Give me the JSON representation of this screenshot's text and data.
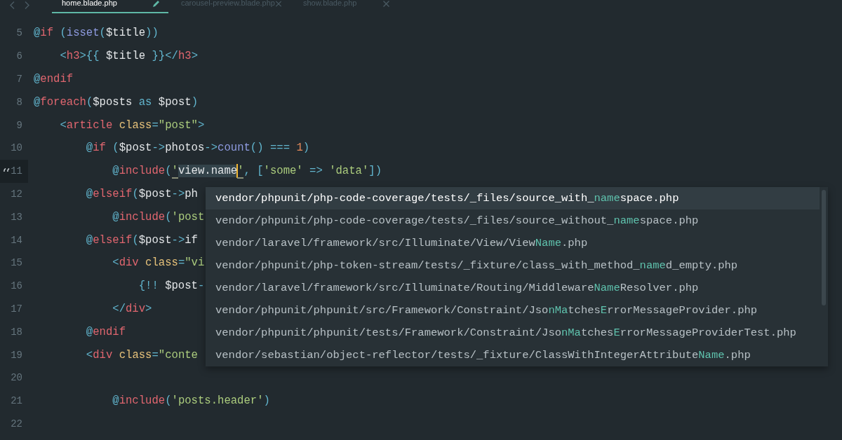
{
  "tabs": [
    {
      "label": "home.blade.php",
      "selected": true,
      "modified": true
    },
    {
      "label": "carousel-preview.blade.php",
      "selected": false,
      "modified": false
    },
    {
      "label": "show.blade.php",
      "selected": false,
      "modified": false
    }
  ],
  "lines": [
    {
      "number": "5",
      "current": false,
      "tokens": [
        {
          "kind": "at",
          "text": "@"
        },
        {
          "kind": "kw",
          "text": "if "
        },
        {
          "kind": "punc",
          "text": "("
        },
        {
          "kind": "fn",
          "text": "isset"
        },
        {
          "kind": "punc",
          "text": "("
        },
        {
          "kind": "var",
          "text": "$title"
        },
        {
          "kind": "punc",
          "text": "))"
        }
      ]
    },
    {
      "number": "6",
      "current": false,
      "tokens": [
        {
          "kind": "punc",
          "text": "    <"
        },
        {
          "kind": "tag",
          "text": "h3"
        },
        {
          "kind": "punc",
          "text": ">{{ "
        },
        {
          "kind": "var",
          "text": "$title "
        },
        {
          "kind": "punc",
          "text": "}}</"
        },
        {
          "kind": "tag",
          "text": "h3"
        },
        {
          "kind": "punc",
          "text": ">"
        }
      ]
    },
    {
      "number": "7",
      "current": false,
      "tokens": [
        {
          "kind": "at",
          "text": "@"
        },
        {
          "kind": "kw",
          "text": "endif"
        }
      ]
    },
    {
      "number": "8",
      "current": false,
      "tokens": [
        {
          "kind": "at",
          "text": "@"
        },
        {
          "kind": "kw",
          "text": "foreach"
        },
        {
          "kind": "punc",
          "text": "("
        },
        {
          "kind": "var",
          "text": "$posts "
        },
        {
          "kind": "punc",
          "text": "as "
        },
        {
          "kind": "var",
          "text": "$post"
        },
        {
          "kind": "punc",
          "text": ")"
        }
      ]
    },
    {
      "number": "9",
      "current": false,
      "tokens": [
        {
          "kind": "punc",
          "text": "    <"
        },
        {
          "kind": "tag",
          "text": "article "
        },
        {
          "kind": "attr",
          "text": "class"
        },
        {
          "kind": "punc",
          "text": "="
        },
        {
          "kind": "str",
          "text": "\"post\""
        },
        {
          "kind": "punc",
          "text": ">"
        }
      ]
    },
    {
      "number": "10",
      "current": false,
      "tokens": [
        {
          "kind": "at",
          "text": "        @"
        },
        {
          "kind": "kw",
          "text": "if "
        },
        {
          "kind": "punc",
          "text": "("
        },
        {
          "kind": "var",
          "text": "$post"
        },
        {
          "kind": "punc",
          "text": "->"
        },
        {
          "kind": "plain",
          "text": "photos"
        },
        {
          "kind": "punc",
          "text": "->"
        },
        {
          "kind": "fn",
          "text": "count"
        },
        {
          "kind": "punc",
          "text": "() === "
        },
        {
          "kind": "num",
          "text": "1"
        },
        {
          "kind": "punc",
          "text": ")"
        }
      ]
    },
    {
      "number": "11",
      "current": true,
      "tokens": [
        {
          "kind": "at",
          "text": "            @"
        },
        {
          "kind": "kw",
          "text": "include"
        },
        {
          "kind": "punc",
          "text": "("
        },
        {
          "kind": "quote",
          "text": "'"
        },
        {
          "kind": "sel",
          "text": "view.name"
        },
        {
          "kind": "quote",
          "text": "'"
        },
        {
          "kind": "punc",
          "text": ", ["
        },
        {
          "kind": "str",
          "text": "'some' "
        },
        {
          "kind": "punc",
          "text": "=> "
        },
        {
          "kind": "str",
          "text": "'data'"
        },
        {
          "kind": "punc",
          "text": "])"
        }
      ]
    },
    {
      "number": "12",
      "current": false,
      "tokens": [
        {
          "kind": "at",
          "text": "        @"
        },
        {
          "kind": "kw",
          "text": "elseif"
        },
        {
          "kind": "punc",
          "text": "("
        },
        {
          "kind": "var",
          "text": "$post"
        },
        {
          "kind": "punc",
          "text": "->"
        },
        {
          "kind": "plain",
          "text": "ph"
        }
      ]
    },
    {
      "number": "13",
      "current": false,
      "tokens": [
        {
          "kind": "at",
          "text": "            @"
        },
        {
          "kind": "kw",
          "text": "include"
        },
        {
          "kind": "punc",
          "text": "("
        },
        {
          "kind": "str",
          "text": "'post"
        }
      ]
    },
    {
      "number": "14",
      "current": false,
      "tokens": [
        {
          "kind": "at",
          "text": "        @"
        },
        {
          "kind": "kw",
          "text": "elseif"
        },
        {
          "kind": "punc",
          "text": "("
        },
        {
          "kind": "var",
          "text": "$post"
        },
        {
          "kind": "punc",
          "text": "->"
        },
        {
          "kind": "plain",
          "text": "if"
        }
      ]
    },
    {
      "number": "15",
      "current": false,
      "tokens": [
        {
          "kind": "punc",
          "text": "            <"
        },
        {
          "kind": "tag",
          "text": "div "
        },
        {
          "kind": "attr",
          "text": "class"
        },
        {
          "kind": "punc",
          "text": "="
        },
        {
          "kind": "str",
          "text": "\"vi"
        }
      ]
    },
    {
      "number": "16",
      "current": false,
      "tokens": [
        {
          "kind": "punc",
          "text": "                {!! "
        },
        {
          "kind": "var",
          "text": "$post"
        },
        {
          "kind": "punc",
          "text": "-"
        }
      ]
    },
    {
      "number": "17",
      "current": false,
      "tokens": [
        {
          "kind": "punc",
          "text": "            </"
        },
        {
          "kind": "tag",
          "text": "div"
        },
        {
          "kind": "punc",
          "text": ">"
        }
      ]
    },
    {
      "number": "18",
      "current": false,
      "tokens": [
        {
          "kind": "at",
          "text": "        @"
        },
        {
          "kind": "kw",
          "text": "endif"
        }
      ]
    },
    {
      "number": "19",
      "current": false,
      "tokens": [
        {
          "kind": "punc",
          "text": "        <"
        },
        {
          "kind": "tag",
          "text": "div "
        },
        {
          "kind": "attr",
          "text": "class"
        },
        {
          "kind": "punc",
          "text": "="
        },
        {
          "kind": "str",
          "text": "\"conte"
        }
      ]
    },
    {
      "number": "20",
      "current": false
    },
    {
      "number": "21",
      "current": false,
      "tokens": [
        {
          "kind": "at",
          "text": "            @"
        },
        {
          "kind": "kw",
          "text": "include"
        },
        {
          "kind": "punc",
          "text": "("
        },
        {
          "kind": "str",
          "text": "'posts.header'"
        },
        {
          "kind": "punc",
          "text": ")"
        }
      ]
    },
    {
      "number": "22",
      "current": false
    }
  ],
  "completion": {
    "items": [
      {
        "selected": true,
        "parts": [
          {
            "text": "vendor/phpunit/php-code-coverage/tests/_files/source_with_",
            "match": false
          },
          {
            "text": "name",
            "match": true
          },
          {
            "text": "space.php",
            "match": false
          }
        ]
      },
      {
        "selected": false,
        "parts": [
          {
            "text": "vendor/phpunit/php-code-coverage/tests/_files/source_without_",
            "match": false
          },
          {
            "text": "name",
            "match": true
          },
          {
            "text": "space.php",
            "match": false
          }
        ]
      },
      {
        "selected": false,
        "parts": [
          {
            "text": "vendor/laravel/framework/src/Illuminate/View/View",
            "match": false
          },
          {
            "text": "Name",
            "match": true
          },
          {
            "text": ".php",
            "match": false
          }
        ]
      },
      {
        "selected": false,
        "parts": [
          {
            "text": "vendor/phpunit/php-token-stream/tests/_fixture/class_with_method_",
            "match": false
          },
          {
            "text": "name",
            "match": true
          },
          {
            "text": "d_empty.php",
            "match": false
          }
        ]
      },
      {
        "selected": false,
        "parts": [
          {
            "text": "vendor/laravel/framework/src/Illuminate/Routing/Middleware",
            "match": false
          },
          {
            "text": "Name",
            "match": true
          },
          {
            "text": "Resolver.php",
            "match": false
          }
        ]
      },
      {
        "selected": false,
        "parts": [
          {
            "text": "vendor/phpunit/phpunit/src/Framework/Constraint/Jso",
            "match": false
          },
          {
            "text": "nMa",
            "match": true
          },
          {
            "text": "tches",
            "match": false
          },
          {
            "text": "E",
            "match": true
          },
          {
            "text": "rrorMessageProvider.php",
            "match": false
          }
        ]
      },
      {
        "selected": false,
        "parts": [
          {
            "text": "vendor/phpunit/phpunit/tests/Framework/Constraint/Jso",
            "match": false
          },
          {
            "text": "nMa",
            "match": true
          },
          {
            "text": "tches",
            "match": false
          },
          {
            "text": "E",
            "match": true
          },
          {
            "text": "rrorMessageProviderTest.php",
            "match": false
          }
        ]
      },
      {
        "selected": false,
        "parts": [
          {
            "text": "vendor/sebastian/object-reflector/tests/_fixture/ClassWithIntegerAttribute",
            "match": false
          },
          {
            "text": "Name",
            "match": true
          },
          {
            "text": ".php",
            "match": false
          }
        ]
      }
    ]
  }
}
